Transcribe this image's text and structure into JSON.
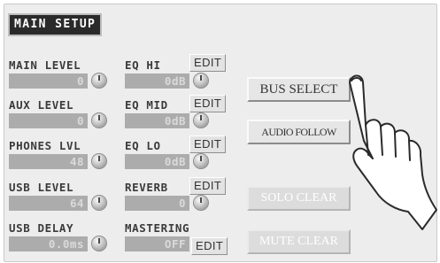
{
  "title": "MAIN SETUP",
  "rows": [
    {
      "label": "MAIN LEVEL",
      "value": "0",
      "eq_label": "EQ HI",
      "eq_value": "0dB",
      "edit": "EDIT"
    },
    {
      "label": "AUX LEVEL",
      "value": "0",
      "eq_label": "EQ MID",
      "eq_value": "0dB",
      "edit": "EDIT"
    },
    {
      "label": "PHONES LVL",
      "value": "48",
      "eq_label": "EQ LO",
      "eq_value": "0dB",
      "edit": "EDIT"
    },
    {
      "label": "USB LEVEL",
      "value": "64",
      "eq_label": "REVERB",
      "eq_value": "0",
      "edit": "EDIT"
    },
    {
      "label": "USB DELAY",
      "value": "0.0ms",
      "eq_label": "MASTERING",
      "eq_value": "OFF",
      "edit": "EDIT"
    }
  ],
  "buttons": {
    "bus_select": "BUS SELECT",
    "audio_follow": "AUDIO FOLLOW",
    "solo_clear": "SOLO CLEAR",
    "mute_clear": "MUTE CLEAR"
  },
  "icons": {
    "knob": "rotary-knob-icon",
    "hand": "pointing-hand-icon"
  },
  "colors": {
    "screen_bg": "#ededed",
    "value_field": "#acacac",
    "title_bg": "#2a2a2a"
  }
}
